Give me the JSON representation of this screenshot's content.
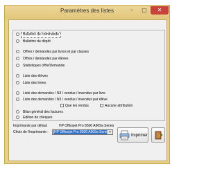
{
  "window": {
    "title": "Paramètres des listes"
  },
  "options": [
    {
      "label": "Bulletins de commande",
      "selected": true,
      "boxed": true
    },
    {
      "label": "Bulletins de dépôt"
    },
    {
      "label": "Offres / demandes par livres et par classes"
    },
    {
      "label": "Offres / demandes par élèves"
    },
    {
      "label": "Statistiques offre/Demande"
    },
    {
      "label": "Liste des élèves"
    },
    {
      "label": "Liste des livres"
    },
    {
      "label": "Liste des demandes / N3 / vendus / invendus par livre"
    },
    {
      "label": "Liste des demandes / N3 / vendus / invendus par élève"
    },
    {
      "label": "Bilan général des factures"
    },
    {
      "label": "Edition de chèques"
    }
  ],
  "checkboxes": {
    "sold_only": "Que les rendus",
    "no_assignment": "Aucune attribution"
  },
  "printer": {
    "default_label": "Imprimante par défaut",
    "default_value": "HP Officejet Pro 8500 A909a Series",
    "choice_label": "Choix de l'imprimante :",
    "choice_value": "HP Officejet Pro 8500 A909a Series"
  },
  "buttons": {
    "print": "Imprimer"
  }
}
